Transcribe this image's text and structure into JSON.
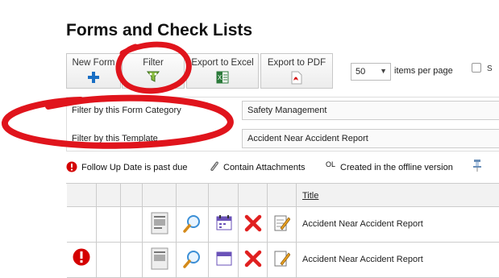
{
  "page": {
    "title": "Forms and Check Lists"
  },
  "toolbar": {
    "new_form": "New Form",
    "filter": "Filter",
    "export_excel": "Export to Excel",
    "export_pdf": "Export to PDF",
    "per_page_value": "50",
    "per_page_label": "items per page",
    "checkbox_label": "S"
  },
  "filters": {
    "category_label": "Filter by this Form Category",
    "category_value": "Safety Management",
    "template_label": "Filter by this Template",
    "template_value": "Accident Near Accident Report"
  },
  "legend": {
    "followup": "Follow Up Date is past due",
    "attachments": "Contain Attachments",
    "offline_code": "OL",
    "offline": "Created in the offline version"
  },
  "table": {
    "columns": {
      "title": "Title"
    },
    "rows": [
      {
        "title": "Accident Near Accident Report"
      },
      {
        "title": "Accident Near Accident Report"
      }
    ]
  },
  "colors": {
    "annotation": "#e0141c",
    "brand_blue": "#1a6fc4",
    "alert_red": "#d40000"
  }
}
